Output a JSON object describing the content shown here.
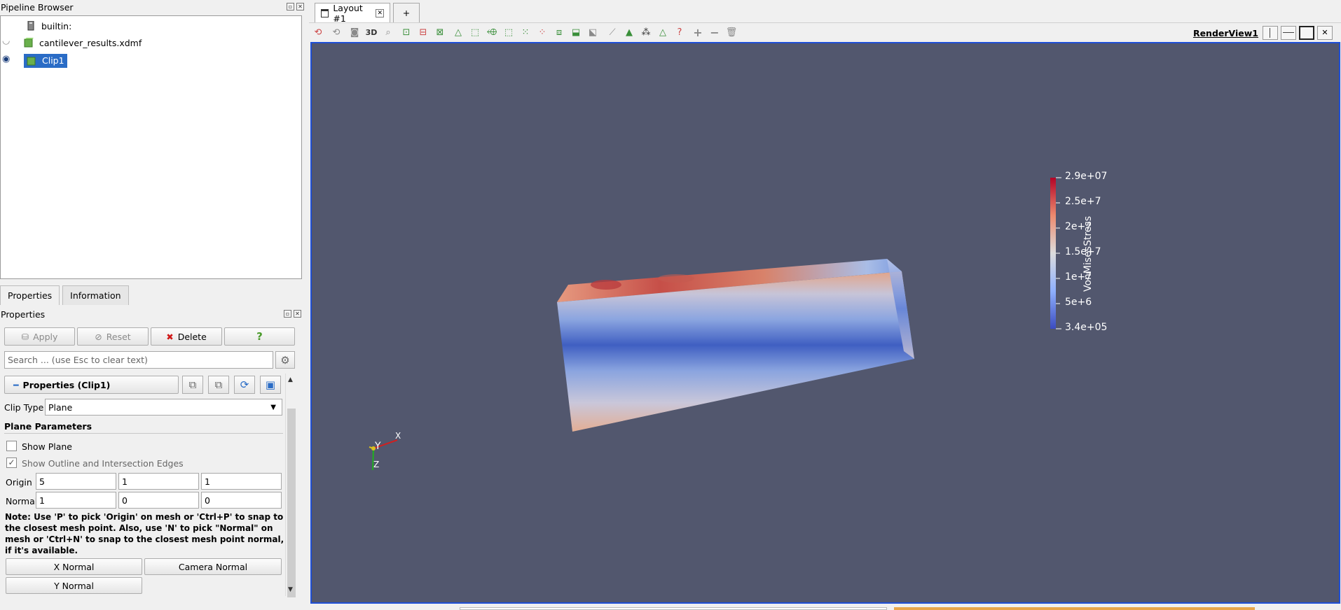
{
  "pipeline_browser": {
    "title": "Pipeline Browser",
    "items": [
      {
        "label": "builtin:"
      },
      {
        "label": "cantilever_results.xdmf"
      },
      {
        "label": "Clip1"
      }
    ]
  },
  "tabs": {
    "properties": "Properties",
    "information": "Information"
  },
  "properties": {
    "title": "Properties",
    "apply": "Apply",
    "reset": "Reset",
    "delete": "Delete",
    "help": "?",
    "search_placeholder": "Search ... (use Esc to clear text)",
    "section_title": "Properties (Clip1)",
    "clip_type_label": "Clip Type",
    "clip_type_value": "Plane",
    "plane_params": "Plane Parameters",
    "show_plane": "Show Plane",
    "show_outline": "Show Outline and Intersection Edges",
    "origin_label": "Origin",
    "origin": [
      "5",
      "1",
      "1"
    ],
    "normal_label": "Normal",
    "normal": [
      "1",
      "0",
      "0"
    ],
    "note": "Note: Use 'P' to pick 'Origin' on mesh or 'Ctrl+P' to snap to the closest mesh point. Also, use 'N' to pick \"Normal\" on mesh or 'Ctrl+N' to snap to the closest mesh point normal, if it's available.",
    "x_normal": "X Normal",
    "camera_normal": "Camera Normal",
    "y_normal": "Y Normal"
  },
  "layout": {
    "tab_label": "Layout #1",
    "add_tab": "+",
    "three_d": "3D",
    "render_view": "RenderView1"
  },
  "colorbar": {
    "title": "VonMisesStress",
    "labels": [
      "2.9e+07",
      "2.5e+7",
      "2e+7",
      "1.5e+7",
      "1e+7",
      "5e+6",
      "3.4e+05"
    ]
  },
  "axes": {
    "x": "X",
    "y": "Y",
    "z": "Z"
  }
}
